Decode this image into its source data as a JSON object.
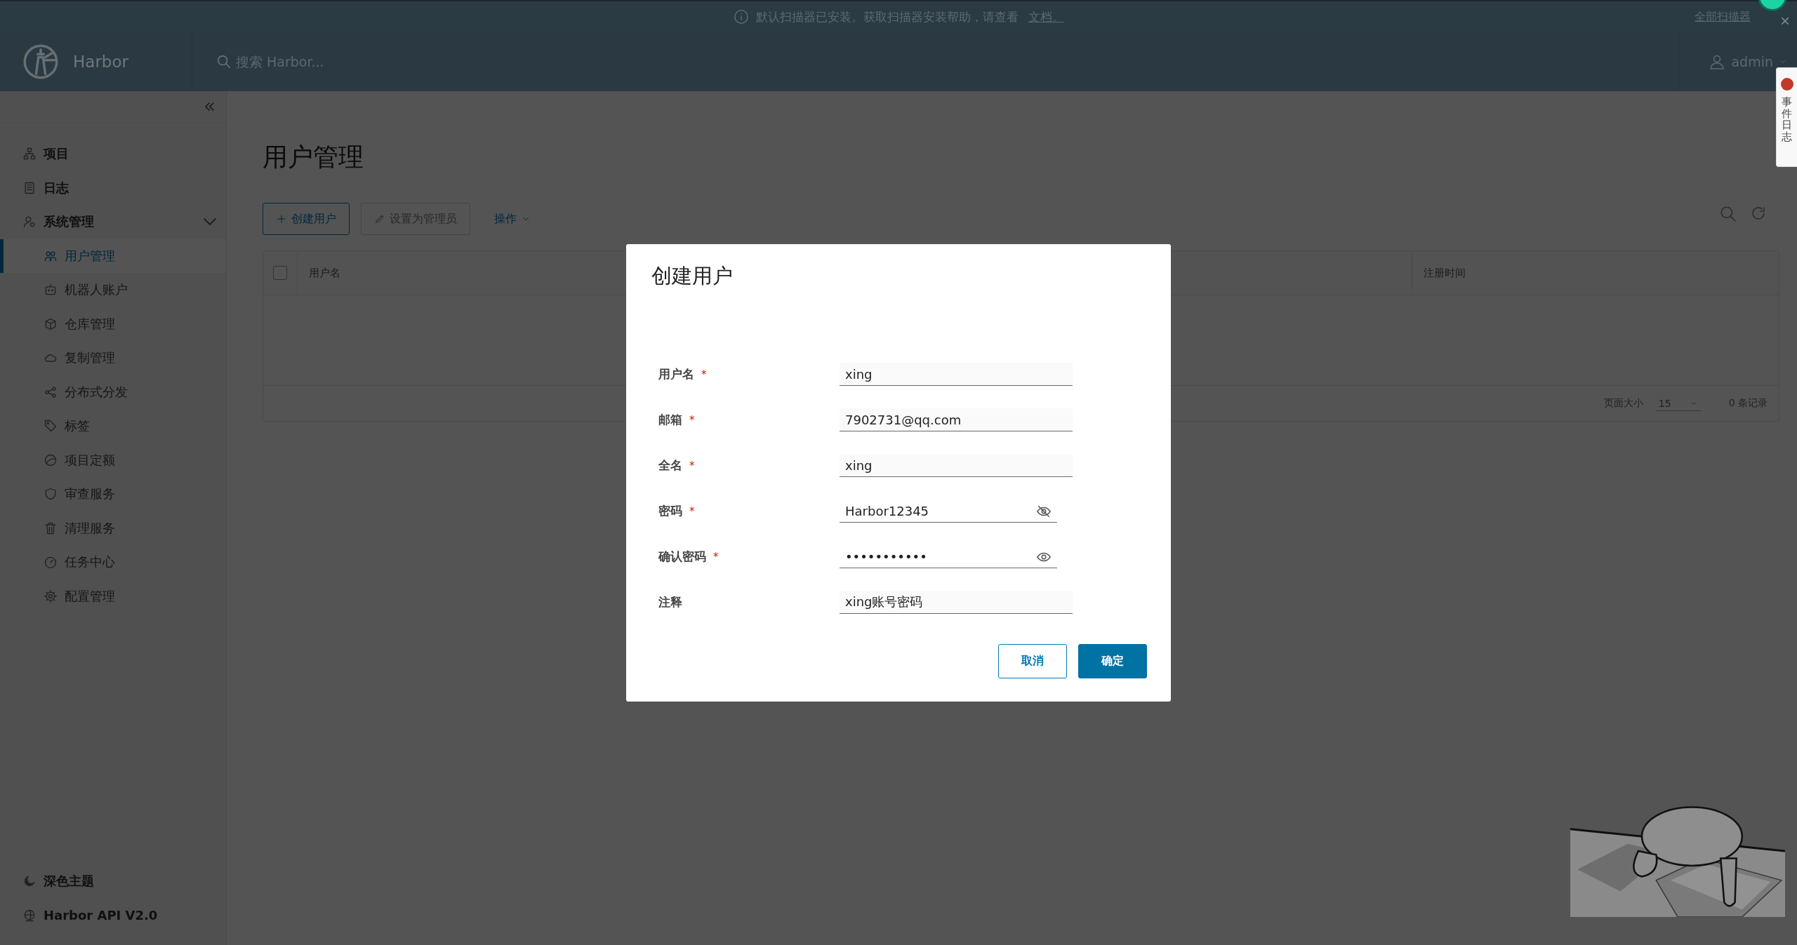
{
  "banner": {
    "message": "默认扫描器已安装。获取扫描器安装帮助，请查看",
    "link": "文档。",
    "action": "全部扫描器",
    "close": "×"
  },
  "header": {
    "brand": "Harbor",
    "search": {
      "placeholder": "搜索 Harbor..."
    },
    "user": "admin"
  },
  "sidebar": {
    "items": [
      {
        "label": "项目",
        "selected": false
      },
      {
        "label": "日志",
        "selected": false
      },
      {
        "label": "系统管理",
        "expanded": true,
        "selected": false,
        "children": [
          {
            "label": "用户管理",
            "selected": true
          },
          {
            "label": "机器人账户",
            "selected": false
          },
          {
            "label": "仓库管理",
            "selected": false
          },
          {
            "label": "复制管理",
            "selected": false
          },
          {
            "label": "分布式分发",
            "selected": false
          },
          {
            "label": "标签",
            "selected": false
          },
          {
            "label": "项目定额",
            "selected": false
          },
          {
            "label": "审查服务",
            "selected": false
          },
          {
            "label": "清理服务",
            "selected": false
          },
          {
            "label": "任务中心",
            "selected": false
          },
          {
            "label": "配置管理",
            "selected": false
          }
        ]
      }
    ],
    "footer": [
      {
        "label": "深色主题"
      },
      {
        "label": "Harbor API V2.0"
      }
    ]
  },
  "page": {
    "title": "用户管理",
    "toolbar": [
      {
        "label": "创建用户",
        "disabled": false,
        "kind": "add"
      },
      {
        "label": "设置为管理员",
        "disabled": true,
        "kind": "edit"
      },
      {
        "label": "操作",
        "disabled": false,
        "kind": "menu"
      }
    ],
    "table": {
      "select_all": {
        "checked": false
      },
      "columns": [
        "用户名",
        "注册时间"
      ],
      "footer": {
        "page_size_label": "页面大小",
        "page_size": "15",
        "count": "0 条记录"
      }
    }
  },
  "event_log": {
    "label": "事件日志"
  },
  "dialog": {
    "title": "创建用户",
    "required_marker": "*",
    "fields": [
      {
        "label": "用户名",
        "required": true,
        "kind": "text",
        "value": "xing"
      },
      {
        "label": "邮箱",
        "required": true,
        "kind": "text",
        "value": "7902731@qq.com"
      },
      {
        "label": "全名",
        "required": true,
        "kind": "text",
        "value": "xing"
      },
      {
        "label": "密码",
        "required": true,
        "kind": "password",
        "revealed": true,
        "value": "Harbor12345"
      },
      {
        "label": "确认密码",
        "required": true,
        "kind": "password",
        "revealed": false,
        "value": "•••••••••••"
      },
      {
        "label": "注释",
        "required": false,
        "kind": "text",
        "value": "xing账号密码"
      }
    ],
    "buttons": [
      {
        "label": "取消",
        "kind": "secondary"
      },
      {
        "label": "确定",
        "kind": "primary"
      }
    ]
  }
}
